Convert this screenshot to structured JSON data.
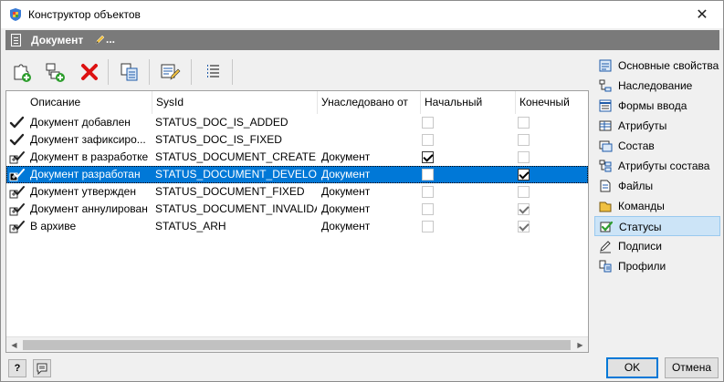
{
  "window": {
    "title": "Конструктор объектов",
    "app_icon": "shield-cube-icon",
    "close_icon": "close-icon",
    "close_glyph": "✕"
  },
  "header": {
    "title": "Документ",
    "suffix": "..."
  },
  "toolbar": {
    "buttons": [
      {
        "name": "add-status-button",
        "icon": "add-puzzle-icon"
      },
      {
        "name": "add-child-button",
        "icon": "add-tree-icon"
      },
      {
        "name": "delete-button",
        "icon": "delete-x-icon"
      },
      {
        "name": "copy-button",
        "icon": "copy-icon"
      },
      {
        "name": "edit-button",
        "icon": "edit-list-icon"
      },
      {
        "name": "list-button",
        "icon": "list-icon"
      }
    ]
  },
  "grid": {
    "columns": [
      "Описание",
      "SysId",
      "Унаследовано от",
      "Начальный",
      "Конечный"
    ],
    "rows": [
      {
        "icon": "check-mark-icon",
        "description": "Документ добавлен",
        "sysid": "STATUS_DOC_IS_ADDED",
        "inherited": "",
        "initial": false,
        "final": false,
        "grey": true
      },
      {
        "icon": "check-mark-icon",
        "description": "Документ зафиксиро...",
        "sysid": "STATUS_DOC_IS_FIXED",
        "inherited": "",
        "initial": false,
        "final": false,
        "grey": true
      },
      {
        "icon": "inherited-check-icon",
        "description": "Документ в разработке",
        "sysid": "STATUS_DOCUMENT_CREATED",
        "inherited": "Документ",
        "initial": true,
        "final": false,
        "grey": false
      },
      {
        "icon": "inherited-check-icon",
        "description": "Документ разработан",
        "sysid": "STATUS_DOCUMENT_DEVELOPED",
        "inherited": "Документ",
        "initial": false,
        "final": true,
        "grey": false,
        "selected": true
      },
      {
        "icon": "inherited-check-icon",
        "description": "Документ утвержден",
        "sysid": "STATUS_DOCUMENT_FIXED",
        "inherited": "Документ",
        "initial": false,
        "final": false,
        "grey": true
      },
      {
        "icon": "inherited-check-icon",
        "description": "Документ аннулирован",
        "sysid": "STATUS_DOCUMENT_INVALIDA...",
        "inherited": "Документ",
        "initial": false,
        "final": true,
        "grey": true
      },
      {
        "icon": "inherited-check-icon",
        "description": "В архиве",
        "sysid": "STATUS_ARH",
        "inherited": "Документ",
        "initial": false,
        "final": true,
        "grey": true
      }
    ]
  },
  "sidebar": {
    "items": [
      {
        "label": "Основные свойства",
        "icon": "properties-icon"
      },
      {
        "label": "Наследование",
        "icon": "inheritance-icon"
      },
      {
        "label": "Формы ввода",
        "icon": "form-icon"
      },
      {
        "label": "Атрибуты",
        "icon": "attributes-icon"
      },
      {
        "label": "Состав",
        "icon": "composition-icon"
      },
      {
        "label": "Атрибуты состава",
        "icon": "composition-attributes-icon"
      },
      {
        "label": "Файлы",
        "icon": "files-icon"
      },
      {
        "label": "Команды",
        "icon": "commands-icon"
      },
      {
        "label": "Статусы",
        "icon": "statuses-icon",
        "active": true
      },
      {
        "label": "Подписи",
        "icon": "signatures-icon"
      },
      {
        "label": "Профили",
        "icon": "profiles-icon"
      }
    ]
  },
  "footer": {
    "help_icon": "help-icon",
    "help_glyph": "?",
    "comment_icon": "comment-icon",
    "ok_label": "OK",
    "cancel_label": "Отмена"
  }
}
